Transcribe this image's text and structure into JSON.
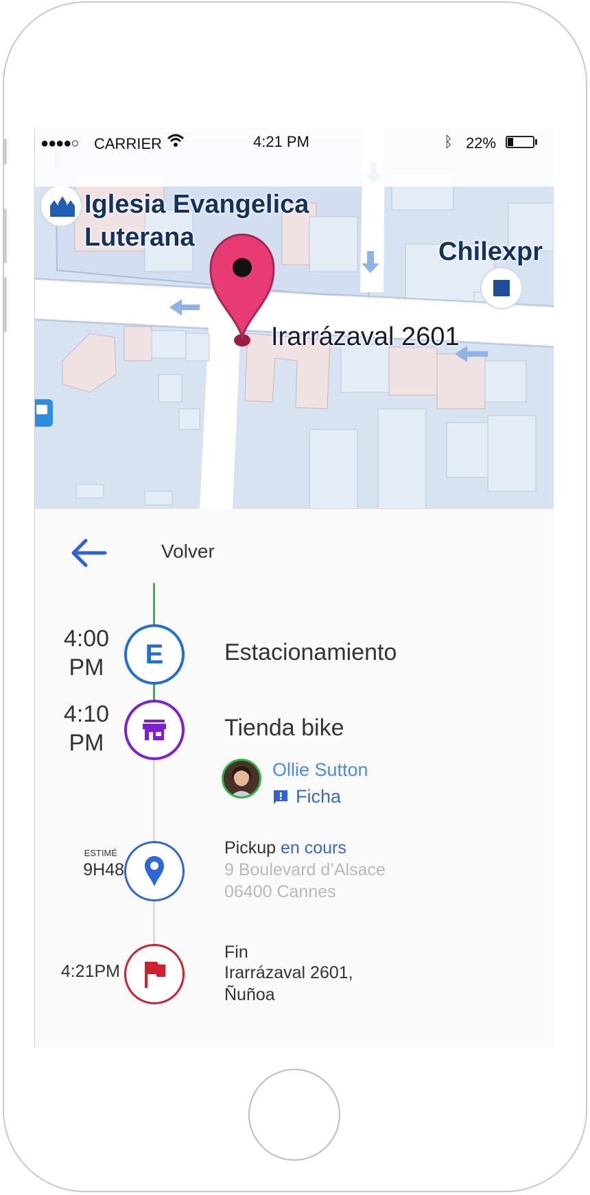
{
  "status_bar": {
    "signal": "●●●●○",
    "carrier": "CARRIER",
    "time": "4:21 PM",
    "battery": "22%",
    "battery_level": 0.22
  },
  "map": {
    "poi_church": "Iglesia Evangelica\nLuterana",
    "poi_courier": "Chilexpr",
    "address_label": "Irarrázaval 2601"
  },
  "nav": {
    "back_label": "Volver"
  },
  "timeline": {
    "stop1": {
      "time": "4:00\nPM",
      "badge": "E",
      "title": "Estacionamiento"
    },
    "stop2": {
      "time": "4:10\nPM",
      "title": "Tienda bike",
      "contact_name": "Ollie Sutton",
      "file_link": "Ficha"
    },
    "stop3": {
      "eta_label": "ESTIMÉ",
      "eta": "9H48",
      "title": "Pickup",
      "status": "en cours",
      "address_line1": "9 Boulevard d’Alsace",
      "address_line2": "06400 Cannes"
    },
    "stop4": {
      "time": "4:21PM",
      "title": "Fin",
      "address_line1": "Irarrázaval 2601,",
      "address_line2": "Ñuñoa"
    }
  },
  "colors": {
    "route_done": "#2fb84a",
    "route_pending": "#dddddd",
    "stop1": "#1f6fd6",
    "stop2": "#7b1fd9",
    "stop3": "#2d67d8",
    "stop4": "#d0202f",
    "pin": "#e83a73"
  }
}
